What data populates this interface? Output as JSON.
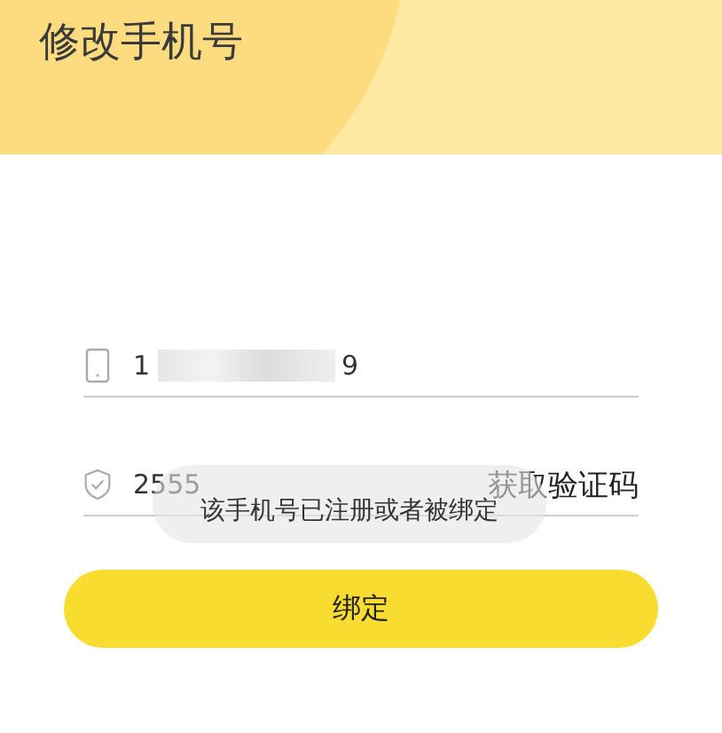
{
  "header": {
    "title": "修改手机号"
  },
  "phone_field": {
    "value_start": "1",
    "value_end": "9",
    "redacted": true
  },
  "code_field": {
    "value": "2555",
    "get_code_button": "获取验证码"
  },
  "toast": {
    "message": "该手机号已注册或者被绑定"
  },
  "bind_button": {
    "label": "绑定"
  }
}
